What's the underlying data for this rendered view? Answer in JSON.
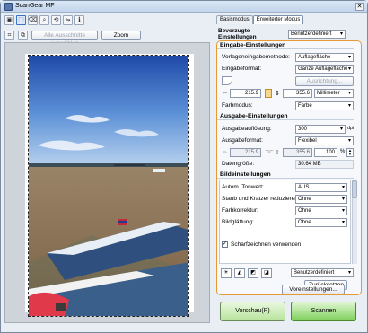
{
  "window": {
    "title": "ScanGear MF"
  },
  "toolbar": {
    "auto_crop_label": "Alle Ausschnitte auswählen",
    "zoom_label": "Zoom"
  },
  "tabs": [
    {
      "label": "Basismodus"
    },
    {
      "label": "Erweiterter Modus"
    }
  ],
  "favorites": {
    "label": "Bevorzugte Einstellungen",
    "value": "Benutzerdefiniert"
  },
  "input_settings": {
    "title": "Eingabe-Einstellungen",
    "select_source_label": "Vorlageneingabemethode:",
    "select_source_value": "Auflagefläche",
    "paper_size_label": "Eingabeformat:",
    "paper_size_value": "Ganze Auflagefläche",
    "orientation_button": "Ausrichtung...",
    "width_value": "215.9",
    "height_value": "355.6",
    "unit_value": "Millimeter",
    "color_mode_label": "Farbmodus:",
    "color_mode_value": "Farbe"
  },
  "output_settings": {
    "title": "Ausgabe-Einstellungen",
    "resolution_label": "Ausgabeauflösung:",
    "resolution_value": "300",
    "resolution_unit": "dpi",
    "output_size_label": "Ausgabeformat:",
    "output_size_value": "Flexibel",
    "out_width_value": "215.9",
    "out_height_value": "355.6",
    "scale_value": "100",
    "scale_unit": "%",
    "data_size_label": "Datengröße:",
    "data_size_value": "30.64 MB"
  },
  "image_settings": {
    "title": "Bildeinstellungen",
    "auto_tone_label": "Autom. Tonwert:",
    "auto_tone_value": "AUS",
    "dust_label": "Staub und Kratzer reduzieren:",
    "dust_value": "Ohne",
    "fading_label": "Farbkorrektur:",
    "fading_value": "Ohne",
    "grain_label": "Bildglättung:",
    "grain_value": "Ohne",
    "sharpen_label": "Scharfzeichnen verwenden",
    "custom_value": "Benutzerdefiniert",
    "reset_label": "Zurücksetzen",
    "preferences_label": "Voreinstellungen..."
  },
  "actions": {
    "preview_label": "Vorschau(P)",
    "scan_label": "Scannen"
  },
  "icons": {
    "app": "app-icon",
    "close": "close-icon"
  }
}
